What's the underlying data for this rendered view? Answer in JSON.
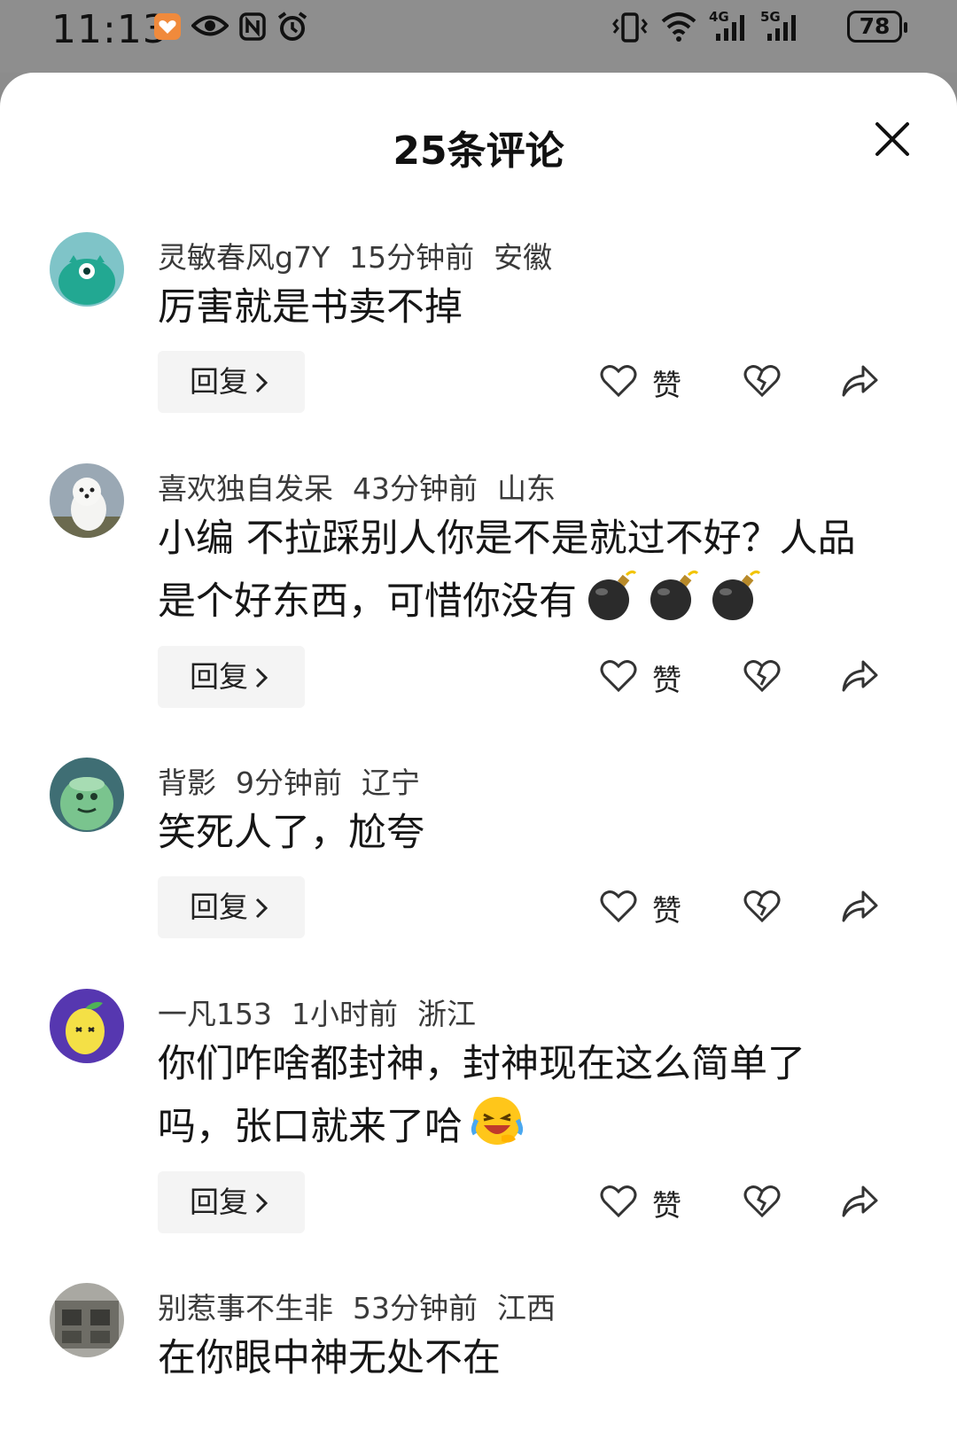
{
  "status_bar": {
    "time": "11:13",
    "battery": "78",
    "network_4g": "4G",
    "network_5g": "5G"
  },
  "sheet": {
    "title": "25条评论"
  },
  "comments": [
    {
      "user": "灵敏春风g7Y",
      "time": "15分钟前",
      "location": "安徽",
      "text": "厉害就是书卖不掉",
      "reply_label": "回复",
      "like_label": "赞",
      "avatar_color": "#2bb3a0"
    },
    {
      "user": "喜欢独自发呆",
      "time": "43分钟前",
      "location": "山东",
      "text": "小编 不拉踩别人你是不是就过不好？人品是个好东西，可惜你没有",
      "emojis": [
        "bomb-emoji",
        "bomb-emoji",
        "bomb-emoji"
      ],
      "reply_label": "回复",
      "like_label": "赞",
      "avatar_color": "#b7c1c9"
    },
    {
      "user": "背影",
      "time": "9分钟前",
      "location": "辽宁",
      "text": "笑死人了，尬夸",
      "reply_label": "回复",
      "like_label": "赞",
      "avatar_color": "#6fae8a"
    },
    {
      "user": "一凡153",
      "time": "1小时前",
      "location": "浙江",
      "text": "你们咋啥都封神，封神现在这么简单了吗，张口就来了哈",
      "emojis": [
        "laughing-crying-emoji"
      ],
      "reply_label": "回复",
      "like_label": "赞",
      "avatar_color": "#5b3fb0"
    },
    {
      "user": "别惹事不生非",
      "time": "53分钟前",
      "location": "江西",
      "text": "在你眼中神无处不在",
      "avatar_color": "#8a8a86"
    }
  ]
}
